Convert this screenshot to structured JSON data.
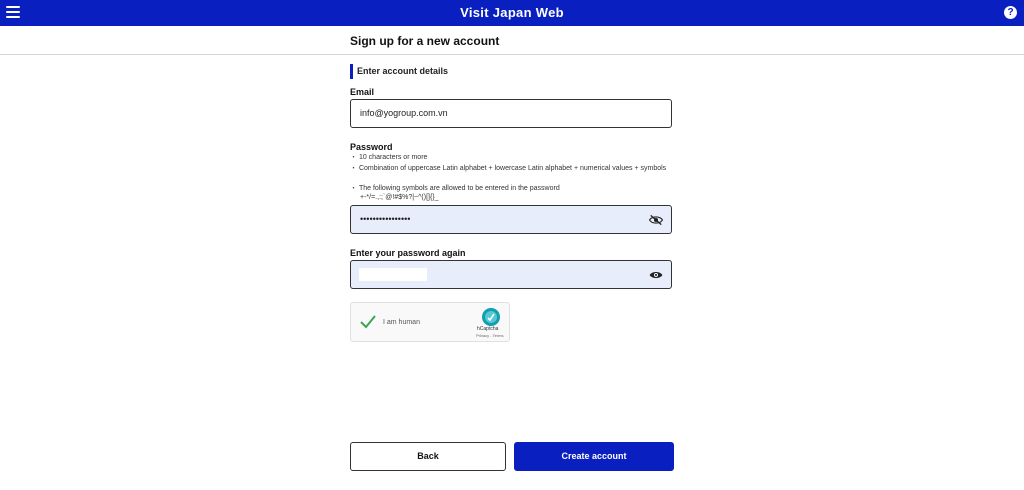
{
  "header": {
    "title": "Visit Japan Web",
    "menu_icon": "menu-icon",
    "help_icon": "help-icon",
    "help_glyph": "?"
  },
  "page": {
    "title": "Sign up for a new account",
    "section_heading": "Enter account details"
  },
  "email": {
    "label": "Email",
    "value": "info@yogroup.com.vn"
  },
  "password": {
    "label": "Password",
    "hints": [
      "・ 10 characters or more",
      "・ Combination of uppercase Latin alphabet + lowercase Latin alphabet + numerical values + symbols",
      "・ The following symbols are allowed to be entered in the password",
      "+-*/=.,:;`@!#$%?|~^()[]{}_"
    ],
    "masked_value": "••••••••••••••••",
    "toggle_icon": "eye-off-icon"
  },
  "confirm_password": {
    "label": "Enter your password again",
    "toggle_icon": "eye-icon"
  },
  "captcha": {
    "label": "I am human",
    "brand": "hCaptcha",
    "links": "Privacy - Terms",
    "checked": true
  },
  "buttons": {
    "back": "Back",
    "create": "Create account"
  },
  "colors": {
    "brand": "#0a1fc0",
    "field_fill": "#e8edfb"
  }
}
